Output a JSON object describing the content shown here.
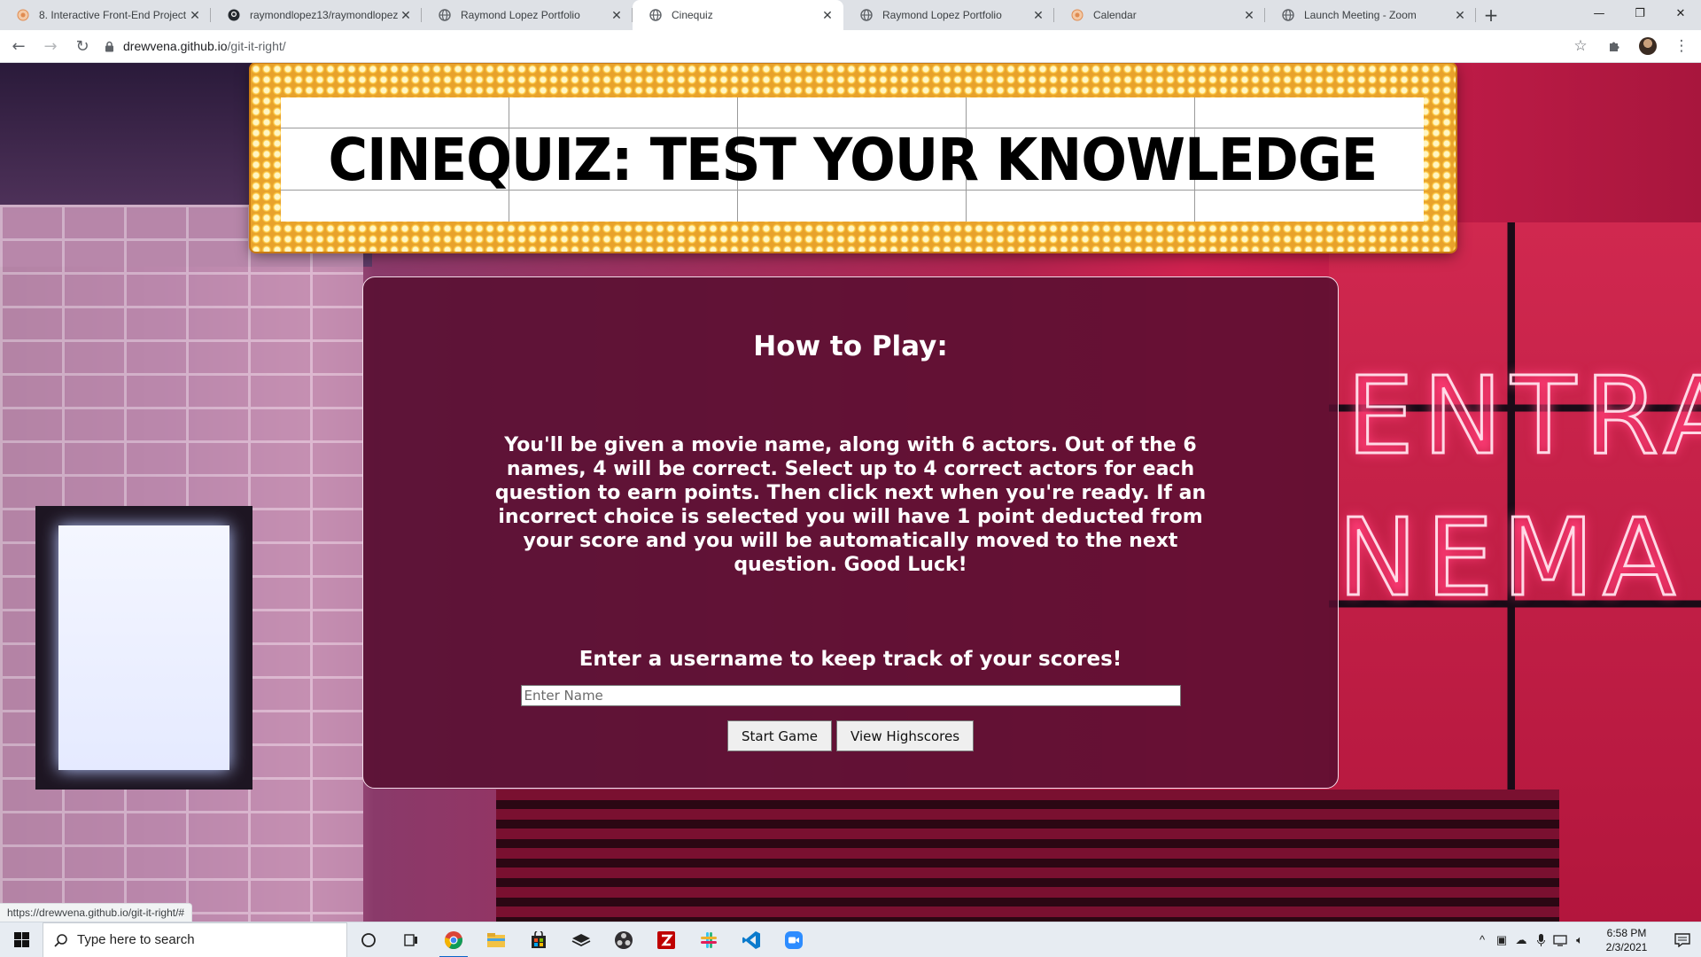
{
  "browser": {
    "tabs": [
      {
        "title": "8. Interactive Front-End Project",
        "icon": "bootcamp-icon",
        "active": false
      },
      {
        "title": "raymondlopez13/raymondlopez13",
        "icon": "github-icon",
        "active": false
      },
      {
        "title": "Raymond Lopez Portfolio",
        "icon": "globe-icon",
        "active": false
      },
      {
        "title": "Cinequiz",
        "icon": "globe-icon",
        "active": true
      },
      {
        "title": "Raymond Lopez Portfolio",
        "icon": "globe-icon",
        "active": false
      },
      {
        "title": "Calendar",
        "icon": "bootcamp-icon",
        "active": false
      },
      {
        "title": "Launch Meeting - Zoom",
        "icon": "globe-icon",
        "active": false
      }
    ],
    "url_host": "drewvena.github.io",
    "url_path": "/git-it-right/",
    "status_url": "https://drewvena.github.io/git-it-right/#"
  },
  "page": {
    "banner_title": "CINEQUIZ: TEST YOUR KNOWLEDGE",
    "how_to_title": "How to Play:",
    "rules": "You'll be given a movie name, along with 6 actors. Out of the 6 names, 4 will be correct. Select up to 4 correct actors for each question to earn points. Then click next when you're ready. If an incorrect choice is selected you will have 1 point deducted from your score and you will be automatically moved to the next question. Good Luck!",
    "username_prompt": "Enter a username to keep track of your scores!",
    "name_placeholder": "Enter Name",
    "name_value": "",
    "start_label": "Start Game",
    "highscores_label": "View Highscores"
  },
  "taskbar": {
    "search_placeholder": "Type here to search",
    "time": "6:58 PM",
    "date": "2/3/2021"
  },
  "colors": {
    "card_bg": "#560e30",
    "marquee_bulb": "#ffcc45",
    "accent": "#0a64c8"
  }
}
